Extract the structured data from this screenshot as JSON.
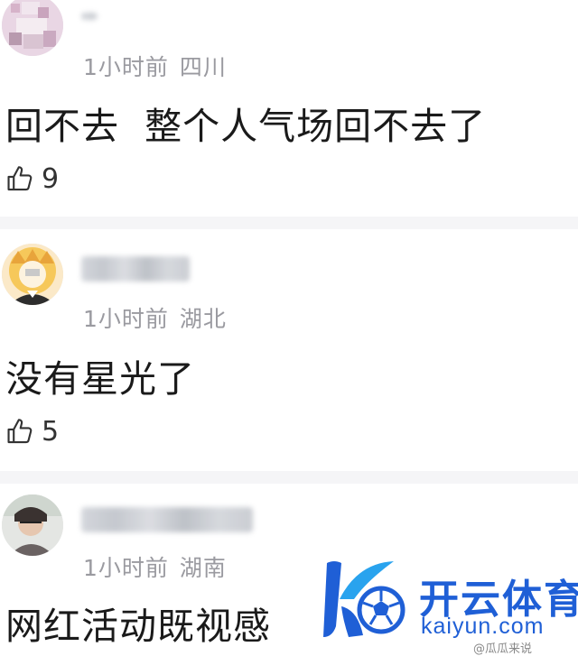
{
  "comments": [
    {
      "time": "1小时前",
      "location": "四川",
      "text": "回不去  整个人气场回不去了",
      "likes": "9"
    },
    {
      "time": "1小时前",
      "location": "湖北",
      "text": "没有星光了",
      "likes": "5"
    },
    {
      "time": "1小时前",
      "location": "湖南",
      "text": "网红活动既视感"
    }
  ],
  "watermark": {
    "brand": "开云体育",
    "domain": "kaiyun.com",
    "credit": "@瓜瓜来说"
  },
  "colors": {
    "accent": "#1f5fd6",
    "meta": "#9a9aa0",
    "text": "#1a1a1a",
    "divider": "#f5f5f7"
  },
  "icons": {
    "like": "thumbs-up-icon"
  }
}
